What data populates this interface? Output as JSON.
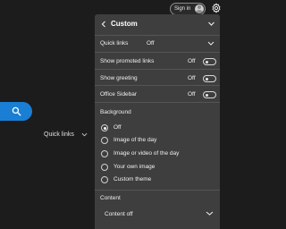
{
  "topbar": {
    "signin_label": "Sign in",
    "icons": {
      "avatar": "avatar-icon",
      "settings": "gear-icon"
    }
  },
  "background_page": {
    "search_icon": "search-icon",
    "quick_links_label": "Quick links"
  },
  "panel": {
    "title": "Custom",
    "back_icon": "chevron-left-icon",
    "close_icon": "chevron-down-icon",
    "quick_links": {
      "label": "Quick links",
      "value": "Off"
    },
    "toggles": [
      {
        "label": "Show promoted links",
        "state": "Off"
      },
      {
        "label": "Show greeting",
        "state": "Off"
      },
      {
        "label": "Office Sidebar",
        "state": "Off"
      }
    ],
    "background": {
      "heading": "Background",
      "selected": "Off",
      "options": [
        "Off",
        "Image of the day",
        "Image or video of the day",
        "Your own image",
        "Custom theme"
      ]
    },
    "content": {
      "heading": "Content",
      "value": "Content off"
    }
  },
  "colors": {
    "page_bg": "#1c1c1c",
    "panel_bg": "#3e3e3e",
    "accent": "#1a7fd4",
    "divider": "#555555",
    "text": "#ffffff"
  }
}
